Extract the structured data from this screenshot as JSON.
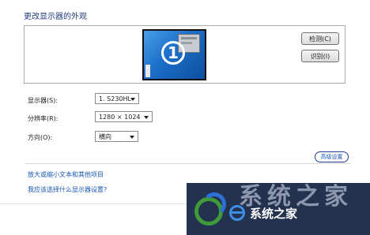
{
  "header": {
    "title": "更改显示器的外观"
  },
  "preview": {
    "monitor_number": "1"
  },
  "buttons": {
    "detect": "检测(C)",
    "identify": "识别(I)"
  },
  "settings": {
    "display": {
      "label": "显示器(S):",
      "value": "1. S230HL"
    },
    "resolution": {
      "label": "分辨率(R):",
      "value": "1280 × 1024"
    },
    "orientation": {
      "label": "方向(O):",
      "value": "横向"
    }
  },
  "advanced": {
    "label": "高级设置"
  },
  "links": {
    "text_size": "放大或缩小文本和其他项目",
    "which_settings": "我应该选择什么显示器设置?"
  },
  "watermark": {
    "big_text": "系统之家",
    "brand": "系统之家"
  },
  "colors": {
    "link": "#1a57b3",
    "title": "#1f3d7a",
    "monitor_blue": "#1c6ec9"
  }
}
